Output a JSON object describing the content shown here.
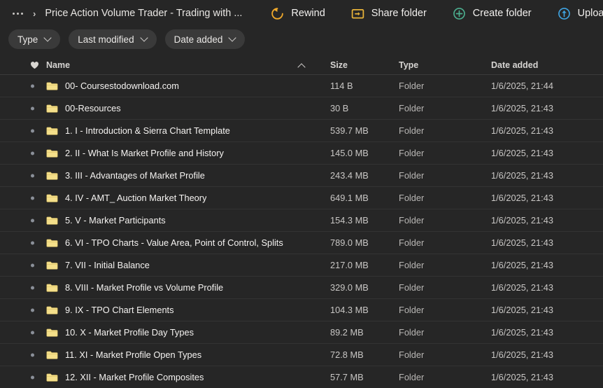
{
  "breadcrumb": {
    "ellipsis_label": "...",
    "separator": "›",
    "current": "Price Action Volume Trader - Trading with ..."
  },
  "toolbar": {
    "buttons": [
      {
        "label": "Rewind",
        "icon": "rewind-icon",
        "color": "#f0a92b"
      },
      {
        "label": "Share folder",
        "icon": "share-folder-icon",
        "color": "#e8b339"
      },
      {
        "label": "Create folder",
        "icon": "create-folder-icon",
        "color": "#4cae8f"
      },
      {
        "label": "Upload...",
        "icon": "upload-icon",
        "color": "#3fa3e0"
      }
    ]
  },
  "filters": [
    {
      "label": "Type"
    },
    {
      "label": "Last modified"
    },
    {
      "label": "Date added"
    }
  ],
  "table": {
    "columns": {
      "name": "Name",
      "size": "Size",
      "type": "Type",
      "date_added": "Date added"
    },
    "sort": {
      "column": "Name",
      "direction": "ascending"
    },
    "favorite_icon": "heart-icon",
    "rows": [
      {
        "name": "00- Coursestodownload.com",
        "size": "114 B",
        "type": "Folder",
        "date": "1/6/2025, 21:44"
      },
      {
        "name": "00-Resources",
        "size": "30 B",
        "type": "Folder",
        "date": "1/6/2025, 21:43"
      },
      {
        "name": "1. I - Introduction & Sierra Chart Template",
        "size": "539.7 MB",
        "type": "Folder",
        "date": "1/6/2025, 21:43"
      },
      {
        "name": "2. II - What Is Market Profile and History",
        "size": "145.0 MB",
        "type": "Folder",
        "date": "1/6/2025, 21:43"
      },
      {
        "name": "3. III - Advantages of Market Profile",
        "size": "243.4 MB",
        "type": "Folder",
        "date": "1/6/2025, 21:43"
      },
      {
        "name": "4. IV - AMT_ Auction Market Theory",
        "size": "649.1 MB",
        "type": "Folder",
        "date": "1/6/2025, 21:43"
      },
      {
        "name": "5. V - Market Participants",
        "size": "154.3 MB",
        "type": "Folder",
        "date": "1/6/2025, 21:43"
      },
      {
        "name": "6. VI - TPO Charts - Value Area, Point of Control, Splits",
        "size": "789.0 MB",
        "type": "Folder",
        "date": "1/6/2025, 21:43"
      },
      {
        "name": "7. VII - Initial Balance",
        "size": "217.0 MB",
        "type": "Folder",
        "date": "1/6/2025, 21:43"
      },
      {
        "name": "8. VIII - Market Profile vs Volume Profile",
        "size": "329.0 MB",
        "type": "Folder",
        "date": "1/6/2025, 21:43"
      },
      {
        "name": "9. IX - TPO Chart Elements",
        "size": "104.3 MB",
        "type": "Folder",
        "date": "1/6/2025, 21:43"
      },
      {
        "name": "10. X - Market Profile Day Types",
        "size": "89.2 MB",
        "type": "Folder",
        "date": "1/6/2025, 21:43"
      },
      {
        "name": "11. XI - Market Profile Open Types",
        "size": "72.8 MB",
        "type": "Folder",
        "date": "1/6/2025, 21:43"
      },
      {
        "name": "12. XII - Market Profile Composites",
        "size": "57.7 MB",
        "type": "Folder",
        "date": "1/6/2025, 21:43"
      }
    ]
  },
  "theme": {
    "background": "#262626",
    "row_divider": "#333333",
    "folder_icon_color": "#f4df8a",
    "text_primary": "#f5f3f1",
    "text_secondary": "#c9c7c5"
  }
}
